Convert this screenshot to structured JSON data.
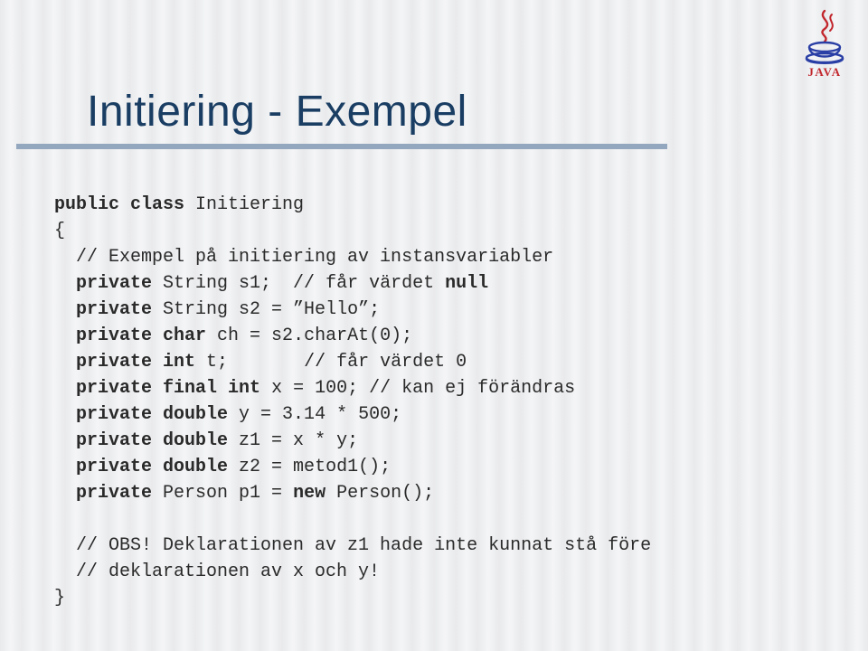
{
  "logo": {
    "wordmark": "JAVA"
  },
  "title": "Initiering - Exempel",
  "code": {
    "l1a": "public class",
    "l1b": " Initiering",
    "l2": "{",
    "l3": "  // Exempel på initiering av instansvariabler",
    "l4a": "  ",
    "l4b": "private",
    "l4c": " String s1;  // får värdet ",
    "l4d": "null",
    "l5a": "  ",
    "l5b": "private",
    "l5c": " String s2 = ”Hello”;",
    "l6a": "  ",
    "l6b": "private char",
    "l6c": " ch = s2.charAt(0);",
    "l7a": "  ",
    "l7b": "private int",
    "l7c": " t;       // får värdet 0",
    "l8a": "  ",
    "l8b": "private final int",
    "l8c": " x = 100; // kan ej förändras",
    "l9a": "  ",
    "l9b": "private double",
    "l9c": " y = 3.14 * 500;",
    "l10a": "  ",
    "l10b": "private double",
    "l10c": " z1 = x * y;",
    "l11a": "  ",
    "l11b": "private double",
    "l11c": " z2 = metod1();",
    "l12a": "  ",
    "l12b": "private",
    "l12c": " Person p1 = ",
    "l12d": "new",
    "l12e": " Person();",
    "l13": "",
    "l14": "  // OBS! Deklarationen av z1 hade inte kunnat stå före",
    "l15": "  // deklarationen av x och y!",
    "l16": "}"
  }
}
